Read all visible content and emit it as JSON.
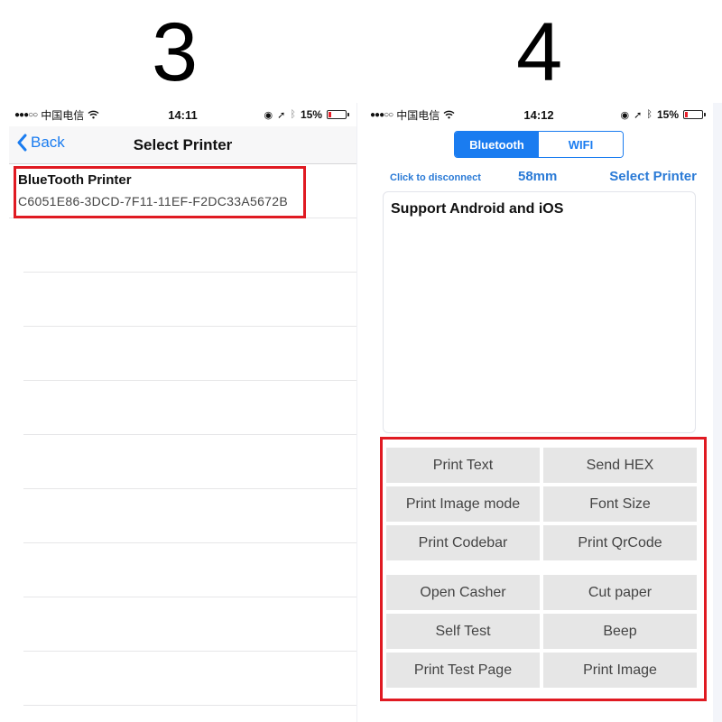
{
  "step_labels": {
    "left": "3",
    "right": "4"
  },
  "left_screen": {
    "status_bar": {
      "signal": "●●●○○",
      "carrier": "中国电信",
      "wifi_icon": "wifi-icon",
      "time": "14:11",
      "lock_icon": "rotation-lock-icon",
      "location_icon": "location-arrow-icon",
      "bluetooth_icon": "bluetooth-icon",
      "battery": "15%",
      "battery_level": 0.15
    },
    "nav": {
      "back_label": "Back",
      "title": "Select Printer"
    },
    "printers": [
      {
        "name": "BlueTooth Printer",
        "id": "C6051E86-3DCD-7F11-11EF-F2DC33A5672B"
      }
    ],
    "empty_rows": 9,
    "highlight_color": "#e01a22"
  },
  "right_screen": {
    "status_bar": {
      "signal": "●●●○○",
      "carrier": "中国电信",
      "wifi_icon": "wifi-icon",
      "time": "14:12",
      "lock_icon": "rotation-lock-icon",
      "location_icon": "location-arrow-icon",
      "bluetooth_icon": "bluetooth-icon",
      "battery": "15%",
      "battery_level": 0.15
    },
    "connection_tabs": [
      {
        "label": "Bluetooth",
        "active": true
      },
      {
        "label": "WIFI",
        "active": false
      }
    ],
    "toolbar": {
      "disconnect": "Click to disconnect",
      "paper_size": "58mm",
      "select_printer": "Select Printer"
    },
    "text_area_value": "Support Android and iOS",
    "actions": [
      [
        "Print Text",
        "Send HEX"
      ],
      [
        "Print Image mode",
        "Font Size"
      ],
      [
        "Print Codebar",
        "Print QrCode"
      ],
      [
        "Open Casher",
        "Cut paper"
      ],
      [
        "Self Test",
        "Beep"
      ],
      [
        "Print Test Page",
        "Print Image"
      ]
    ],
    "accent_color": "#1a7cf0",
    "highlight_color": "#e01a22"
  }
}
